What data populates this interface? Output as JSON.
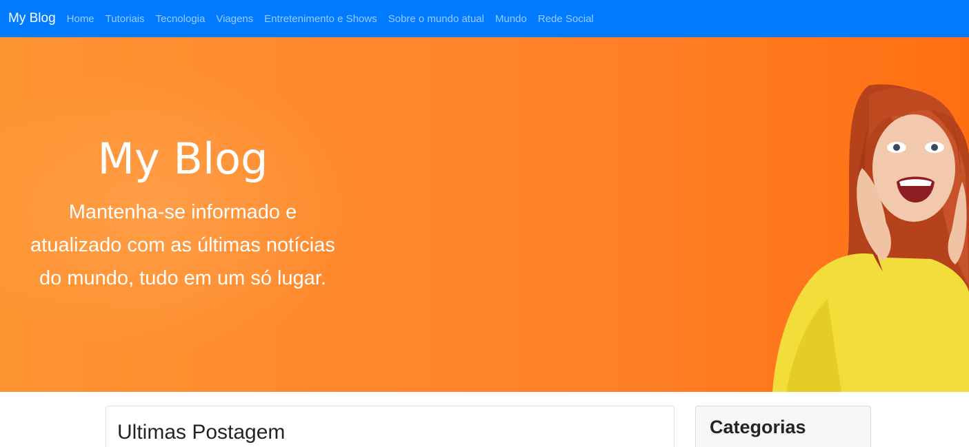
{
  "navbar": {
    "brand": "My Blog",
    "links": [
      "Home",
      "Tutoriais",
      "Tecnologia",
      "Viagens",
      "Entretenimento e Shows",
      "Sobre o mundo atual",
      "Mundo",
      "Rede Social"
    ],
    "color": "#007bff"
  },
  "hero": {
    "title": "My Blog",
    "subtitle_lines": [
      "Mantenha-se informado e",
      "atualizado com as últimas notícias",
      "do mundo, tudo em um só lugar."
    ],
    "color": "#ff8a2d"
  },
  "main": {
    "latest_heading": "Ultimas Postagem"
  },
  "sidebar": {
    "categories_heading": "Categorias"
  }
}
